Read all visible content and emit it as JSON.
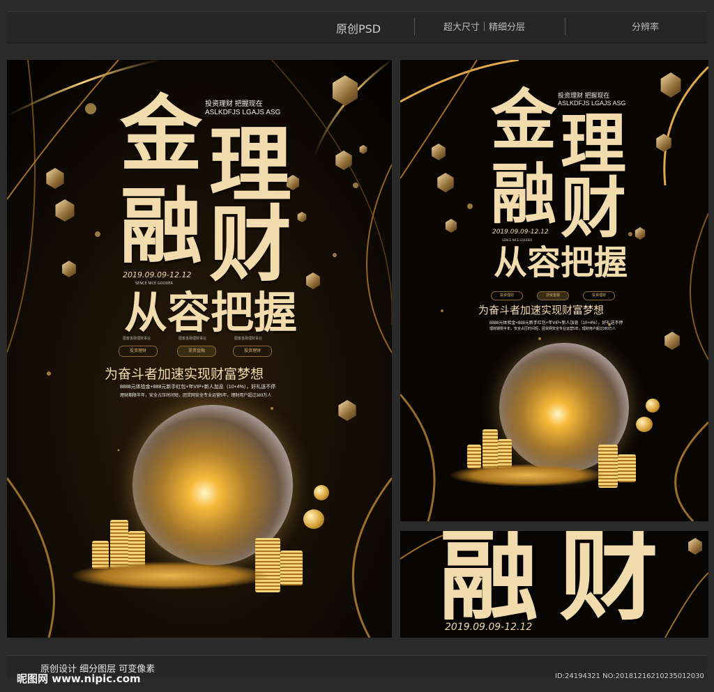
{
  "header": {
    "format": "原创PSD",
    "features": "超大尺寸｜精细分层",
    "resolution": "分辨率"
  },
  "poster": {
    "tagline_cn": "投资理财 把握现在",
    "tagline_en": "ASLKDFJS LGAJS ASG",
    "char_jin": "金",
    "char_li": "理",
    "char_rong": "融",
    "char_cai": "财",
    "date": "2019.09.09-12.12",
    "since": "SENCE NICE GOODER",
    "headline": "从容把握",
    "pills": [
      "图客金融理财事业",
      "图客金融理财事业",
      "图客金融理财事业"
    ],
    "buttons": [
      "投资理财",
      "浙资金融",
      "投资理财"
    ],
    "slogan": "为奋斗者加速实现财富梦想",
    "desc1": "8888元体验金+888元新手红包+年VIP+新人加息（10+4%），好礼送不停",
    "desc2": "理财期限半年，安全占压时间短，团贷网安全专业运营5年，理财用户超过383万人"
  },
  "footer": {
    "note": "原创设计 细分图层 可变像素",
    "watermark": "昵图网 www.nipic.com",
    "id": "ID:24194321 NO:20181216210235012030"
  },
  "colors": {
    "gold": "#f2dcae",
    "background": "#0a0705",
    "page": "#2a2a2a"
  }
}
